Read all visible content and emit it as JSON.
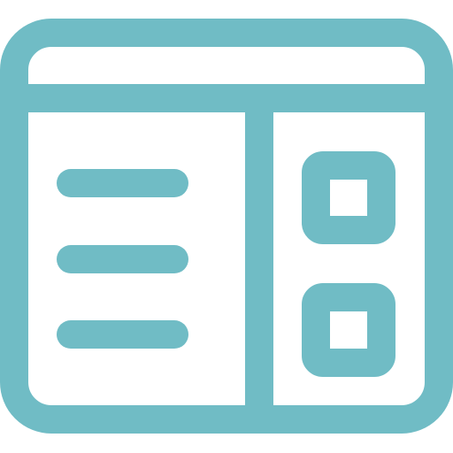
{
  "icon": {
    "name": "browser-window-layout-icon",
    "stroke_color": "#70BCC5",
    "background_color": "#FFFFFF",
    "parts": {
      "frame": "window-frame",
      "title_bar": "title-bar",
      "left_panel": "text-list-panel",
      "right_panel": "widget-panel",
      "text_lines": 3,
      "widgets": 2
    }
  }
}
